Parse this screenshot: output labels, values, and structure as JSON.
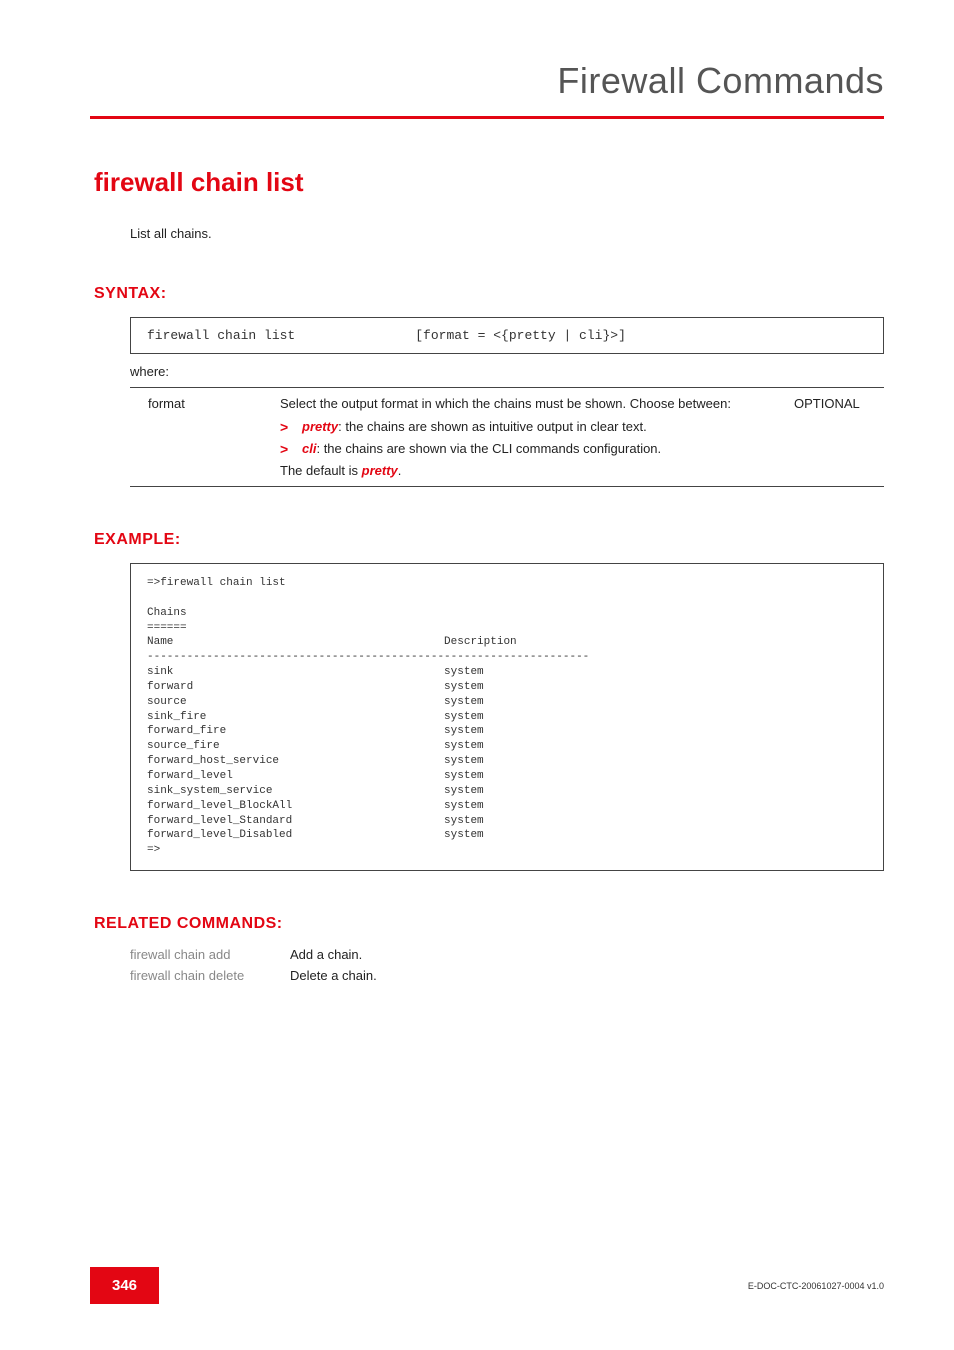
{
  "header": {
    "title": "Firewall Commands"
  },
  "title": "firewall chain list",
  "intro": "List all chains.",
  "syntax": {
    "label": "SYNTAX:",
    "code_left": "firewall chain list",
    "code_right": "[format = <{pretty | cli}>]",
    "where": "where:"
  },
  "param": {
    "name": "format",
    "desc_intro": "Select the output format in which the chains must be shown. Choose between:",
    "bullets": [
      {
        "term": "pretty",
        "rest": ": the chains are shown as intuitive output in clear text."
      },
      {
        "term": "cli",
        "rest": ": the chains are shown via the CLI commands configuration."
      }
    ],
    "default_prefix": "The default is ",
    "default_value": "pretty",
    "default_suffix": ".",
    "req": "OPTIONAL"
  },
  "example": {
    "label": "EXAMPLE:",
    "text": "=>firewall chain list\n\nChains\n======\nName                                         Description\n-------------------------------------------------------------------\nsink                                         system\nforward                                      system\nsource                                       system\nsink_fire                                    system\nforward_fire                                 system\nsource_fire                                  system\nforward_host_service                         system\nforward_level                                system\nsink_system_service                          system\nforward_level_BlockAll                       system\nforward_level_Standard                       system\nforward_level_Disabled                       system\n=>"
  },
  "related": {
    "label": "RELATED COMMANDS:",
    "rows": [
      {
        "cmd": "firewall chain add",
        "desc": "Add a chain."
      },
      {
        "cmd": "firewall chain delete",
        "desc": "Delete a chain."
      }
    ]
  },
  "footer": {
    "page": "346",
    "docid": "E-DOC-CTC-20061027-0004 v1.0"
  }
}
